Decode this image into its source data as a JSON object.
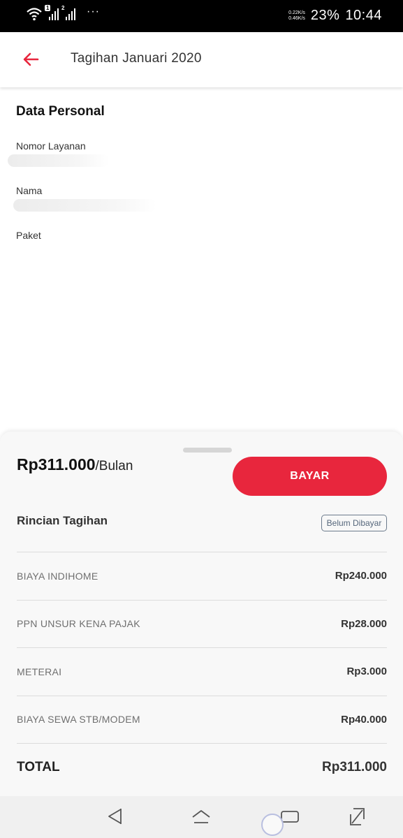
{
  "status_bar": {
    "sim1": "1",
    "sim2": "2",
    "more": "···",
    "speed_up": "0.22K/s",
    "speed_down": "0.46K/s",
    "battery": "23%",
    "time": "10:44"
  },
  "header": {
    "title": "Tagihan Januari 2020"
  },
  "personal": {
    "section_title": "Data Personal",
    "service_number_label": "Nomor Layanan",
    "name_label": "Nama",
    "package_label": "Paket"
  },
  "bill": {
    "price": "Rp311.000",
    "per": "/Bulan",
    "pay_label": "BAYAR",
    "detail_title": "Rincian Tagihan",
    "status": "Belum Dibayar",
    "items": [
      {
        "name": "BIAYA INDIHOME",
        "amount": "Rp240.000"
      },
      {
        "name": "PPN UNSUR KENA PAJAK",
        "amount": "Rp28.000"
      },
      {
        "name": "METERAI",
        "amount": "Rp3.000"
      },
      {
        "name": "BIAYA SEWA STB/MODEM",
        "amount": "Rp40.000"
      }
    ],
    "total_label": "TOTAL",
    "total_amount": "Rp311.000"
  },
  "colors": {
    "accent": "#e8263d",
    "status_badge": "#56677c"
  },
  "icons": {
    "back": "arrow-left-icon",
    "wifi": "wifi-icon",
    "nav_back": "triangle-back-icon",
    "nav_home": "home-icon",
    "nav_recents": "recents-icon",
    "nav_expand": "expand-icon"
  }
}
